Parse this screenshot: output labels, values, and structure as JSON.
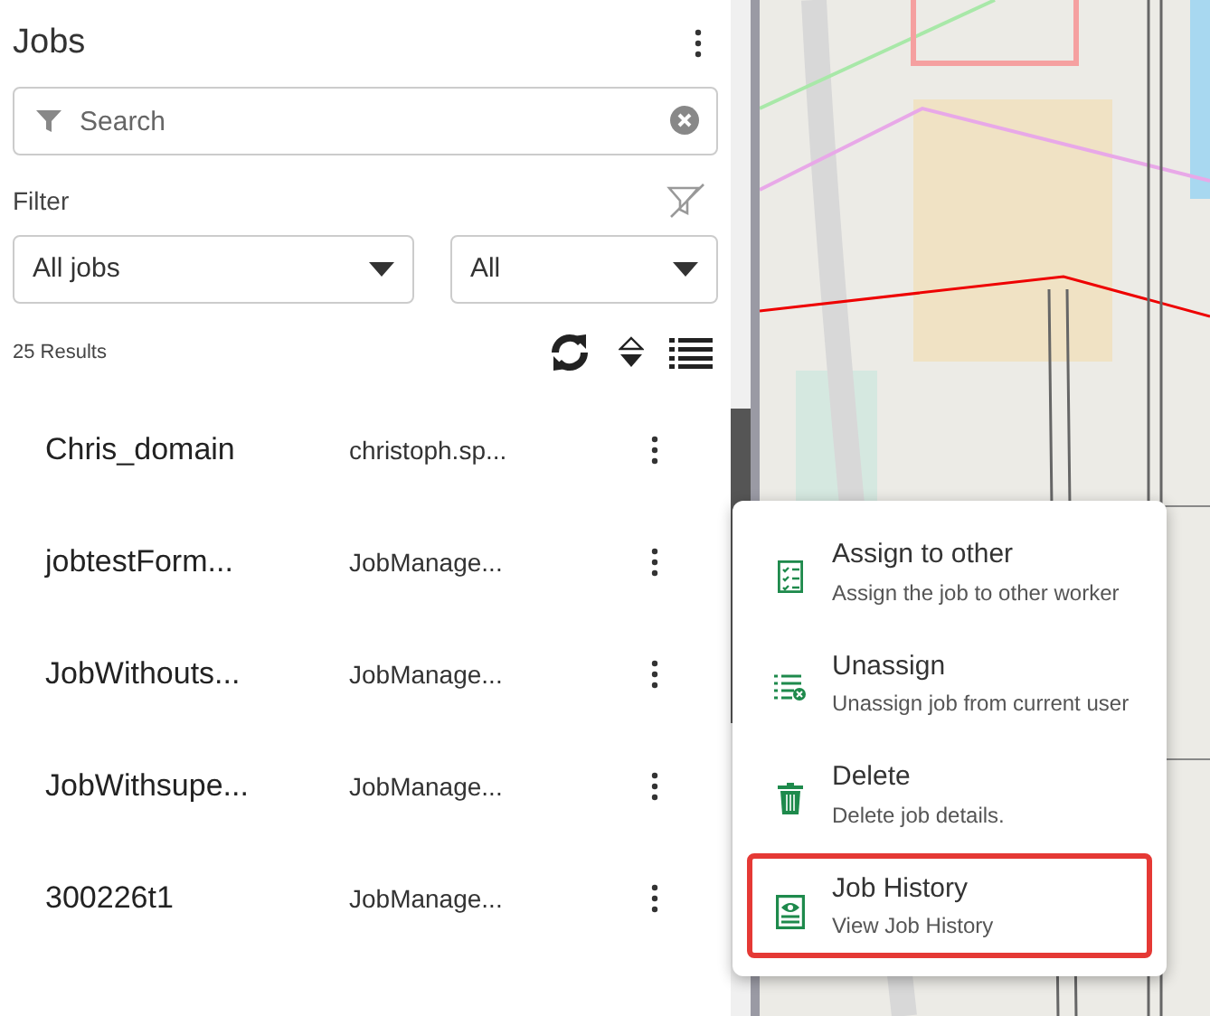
{
  "panel": {
    "title": "Jobs",
    "search": {
      "placeholder": "Search"
    },
    "filter_label": "Filter",
    "filters": [
      {
        "value": "All jobs"
      },
      {
        "value": "All"
      }
    ],
    "results": "25 Results"
  },
  "jobs": [
    {
      "name": "Chris_domain",
      "owner": "christoph.sp..."
    },
    {
      "name": "jobtestForm...",
      "owner": "JobManage..."
    },
    {
      "name": "JobWithouts...",
      "owner": "JobManage..."
    },
    {
      "name": "JobWithsupe...",
      "owner": "JobManage..."
    },
    {
      "name": "300226t1",
      "owner": "JobManage..."
    }
  ],
  "context_menu": [
    {
      "kind": "assign",
      "title": "Assign to other",
      "description": "Assign the job to other worker",
      "highlighted": false
    },
    {
      "kind": "unassign",
      "title": "Unassign",
      "description": "Unassign job from current user",
      "highlighted": false
    },
    {
      "kind": "delete",
      "title": "Delete",
      "description": "Delete job details.",
      "highlighted": false
    },
    {
      "kind": "history",
      "title": "Job History",
      "description": "View Job History",
      "highlighted": true
    }
  ]
}
